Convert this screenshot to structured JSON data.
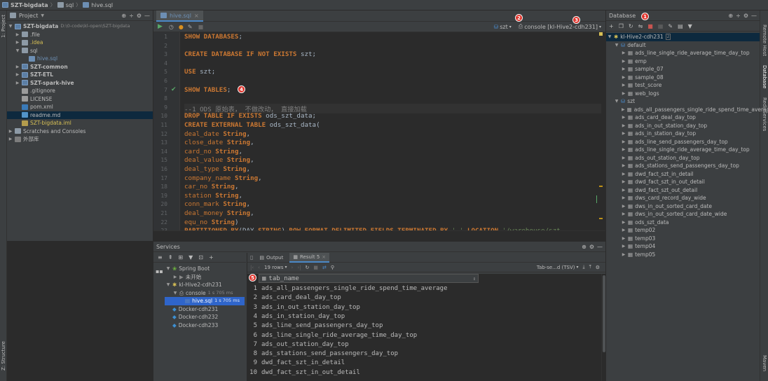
{
  "titlebar": {
    "project": "SZT-bigdata",
    "folder": "sql",
    "file": "hive.sql"
  },
  "leftstrip": {
    "project_tab": "1: Project",
    "structure_tab": "Z: Structure"
  },
  "rightstrip": {
    "remote_host": "Remote Host",
    "database": "Database",
    "redis": "RedisServices",
    "maven": "Maven"
  },
  "project": {
    "title": "Project",
    "tree": [
      {
        "label": "SZT-bigdata",
        "extra": "D:\\0-code\\kl-open\\SZT-bigdata",
        "indent": 0,
        "arrow": "▼",
        "icon": "module",
        "bold": true
      },
      {
        "label": ".file",
        "indent": 1,
        "arrow": "▶",
        "icon": "folder"
      },
      {
        "label": ".idea",
        "indent": 1,
        "arrow": "▶",
        "icon": "folder",
        "color": "yellow"
      },
      {
        "label": "sql",
        "indent": 1,
        "arrow": "▼",
        "icon": "folder"
      },
      {
        "label": "hive.sql",
        "indent": 2,
        "arrow": "",
        "icon": "file-sql",
        "color": "file"
      },
      {
        "label": "SZT-common",
        "indent": 1,
        "arrow": "▶",
        "icon": "module",
        "bold": true
      },
      {
        "label": "SZT-ETL",
        "indent": 1,
        "arrow": "▶",
        "icon": "module",
        "bold": true
      },
      {
        "label": "SZT-spark-hive",
        "indent": 1,
        "arrow": "▶",
        "icon": "module",
        "bold": true
      },
      {
        "label": ".gitignore",
        "indent": 1,
        "arrow": "",
        "icon": "file-txt"
      },
      {
        "label": "LICENSE",
        "indent": 1,
        "arrow": "",
        "icon": "file-txt"
      },
      {
        "label": "pom.xml",
        "indent": 1,
        "arrow": "",
        "icon": "file-xml"
      },
      {
        "label": "readme.md",
        "indent": 1,
        "arrow": "",
        "icon": "file-md",
        "selected": true
      },
      {
        "label": "SZT-bigdata.iml",
        "indent": 1,
        "arrow": "",
        "icon": "file-iml",
        "color": "yellow"
      },
      {
        "label": "Scratches and Consoles",
        "indent": 0,
        "arrow": "▶",
        "icon": "folder"
      },
      {
        "label": "外部库",
        "indent": 0,
        "arrow": "▶",
        "icon": "lib"
      }
    ]
  },
  "editor": {
    "tab": "hive.sql",
    "schema": "szt",
    "console": "console [kl-Hive2-cdh231]",
    "lines": [
      {
        "n": "1",
        "html": "<span class='kw'>SHOW DATABASES</span>;"
      },
      {
        "n": "2",
        "html": ""
      },
      {
        "n": "3",
        "html": "<span class='kw'>CREATE DATABASE IF NOT EXISTS</span> szt;"
      },
      {
        "n": "4",
        "html": ""
      },
      {
        "n": "5",
        "html": "<span class='kw'>USE</span> szt;"
      },
      {
        "n": "6",
        "html": ""
      },
      {
        "n": "7",
        "html": "<span class='kw'>SHOW TABLES</span>;"
      },
      {
        "n": "8",
        "html": ""
      },
      {
        "n": "9",
        "html": "<span class='cm'>--1 ODS 原始表， 不做改动， 直接加载</span>"
      },
      {
        "n": "10",
        "html": "<span class='kw'>DROP TABLE IF EXISTS</span> ods_szt_data;"
      },
      {
        "n": "11",
        "html": "<span class='kw'>CREATE EXTERNAL TABLE</span> ods_szt_data("
      },
      {
        "n": "12",
        "html": "<span class='kwc'>deal_date</span> <span class='kw'>String</span>,"
      },
      {
        "n": "13",
        "html": "<span class='kwc'>close_date</span> <span class='kw'>String</span>,"
      },
      {
        "n": "14",
        "html": "<span class='kwc'>card_no</span> <span class='kw'>String</span>,"
      },
      {
        "n": "15",
        "html": "<span class='kwc'>deal_value</span> <span class='kw'>String</span>,"
      },
      {
        "n": "16",
        "html": "<span class='kwc'>deal_type</span> <span class='kw'>String</span>,"
      },
      {
        "n": "17",
        "html": "<span class='kwc'>company_name</span> <span class='kw'>String</span>,"
      },
      {
        "n": "18",
        "html": "<span class='kwc'>car_no</span> <span class='kw'>String</span>,"
      },
      {
        "n": "19",
        "html": "<span class='kwc'>station</span> <span class='kw'>String</span>,"
      },
      {
        "n": "20",
        "html": "<span class='kwc'>conn_mark</span> <span class='kw'>String</span>,"
      },
      {
        "n": "21",
        "html": "<span class='kwc'>deal_money</span> <span class='kw'>String</span>,"
      },
      {
        "n": "22",
        "html": "<span class='kwc'>equ_no</span> <span class='kw'>String</span>)"
      },
      {
        "n": "23",
        "html": "<span class='kw'>PARTITIONED BY</span>(DAY <span class='kw'>STRING</span>) <span class='kw'>ROW FORMAT DELIMITED FIELDS TERMINATED BY</span> <span class='st'>','</span> <span class='kw'>LOCATION</span> <span class='st'>'/warehouse/szt</span>"
      }
    ]
  },
  "database": {
    "title": "Database",
    "tree": [
      {
        "label": "kl-Hive2-cdh231",
        "indent": 0,
        "arrow": "▼",
        "kind": "conn",
        "selected": true,
        "extra": "2"
      },
      {
        "label": "default",
        "indent": 1,
        "arrow": "▼",
        "kind": "schema"
      },
      {
        "label": "ads_line_single_ride_average_time_day_top",
        "indent": 2,
        "arrow": "▶",
        "kind": "table"
      },
      {
        "label": "emp",
        "indent": 2,
        "arrow": "▶",
        "kind": "table"
      },
      {
        "label": "sample_07",
        "indent": 2,
        "arrow": "▶",
        "kind": "table"
      },
      {
        "label": "sample_08",
        "indent": 2,
        "arrow": "▶",
        "kind": "table"
      },
      {
        "label": "test_score",
        "indent": 2,
        "arrow": "▶",
        "kind": "table"
      },
      {
        "label": "web_logs",
        "indent": 2,
        "arrow": "▶",
        "kind": "table"
      },
      {
        "label": "szt",
        "indent": 1,
        "arrow": "▼",
        "kind": "schema"
      },
      {
        "label": "ads_all_passengers_single_ride_spend_time_average",
        "indent": 2,
        "arrow": "▶",
        "kind": "table"
      },
      {
        "label": "ads_card_deal_day_top",
        "indent": 2,
        "arrow": "▶",
        "kind": "table"
      },
      {
        "label": "ads_in_out_station_day_top",
        "indent": 2,
        "arrow": "▶",
        "kind": "table"
      },
      {
        "label": "ads_in_station_day_top",
        "indent": 2,
        "arrow": "▶",
        "kind": "table"
      },
      {
        "label": "ads_line_send_passengers_day_top",
        "indent": 2,
        "arrow": "▶",
        "kind": "table"
      },
      {
        "label": "ads_line_single_ride_average_time_day_top",
        "indent": 2,
        "arrow": "▶",
        "kind": "table"
      },
      {
        "label": "ads_out_station_day_top",
        "indent": 2,
        "arrow": "▶",
        "kind": "table"
      },
      {
        "label": "ads_stations_send_passengers_day_top",
        "indent": 2,
        "arrow": "▶",
        "kind": "table"
      },
      {
        "label": "dwd_fact_szt_in_detail",
        "indent": 2,
        "arrow": "▶",
        "kind": "table"
      },
      {
        "label": "dwd_fact_szt_in_out_detail",
        "indent": 2,
        "arrow": "▶",
        "kind": "table"
      },
      {
        "label": "dwd_fact_szt_out_detail",
        "indent": 2,
        "arrow": "▶",
        "kind": "table"
      },
      {
        "label": "dws_card_record_day_wide",
        "indent": 2,
        "arrow": "▶",
        "kind": "table"
      },
      {
        "label": "dws_in_out_sorted_card_date",
        "indent": 2,
        "arrow": "▶",
        "kind": "table"
      },
      {
        "label": "dws_in_out_sorted_card_date_wide",
        "indent": 2,
        "arrow": "▶",
        "kind": "table"
      },
      {
        "label": "ods_szt_data",
        "indent": 2,
        "arrow": "▶",
        "kind": "table"
      },
      {
        "label": "temp02",
        "indent": 2,
        "arrow": "▶",
        "kind": "table"
      },
      {
        "label": "temp03",
        "indent": 2,
        "arrow": "▶",
        "kind": "table"
      },
      {
        "label": "temp04",
        "indent": 2,
        "arrow": "▶",
        "kind": "table"
      },
      {
        "label": "temp05",
        "indent": 2,
        "arrow": "▶",
        "kind": "table"
      }
    ]
  },
  "services": {
    "title": "Services",
    "tree": [
      {
        "label": "Spring Boot",
        "indent": 0,
        "arrow": "▼",
        "kind": "spring"
      },
      {
        "label": "未开始",
        "indent": 1,
        "arrow": "▶",
        "kind": "none"
      },
      {
        "label": "kl-Hive2-cdh231",
        "indent": 0,
        "arrow": "▼",
        "kind": "conn"
      },
      {
        "label": "console",
        "extra": "1 s 705 ms",
        "indent": 1,
        "arrow": "▼",
        "kind": "console"
      },
      {
        "label": "hive.sql",
        "extra": "1 s 705 ms",
        "indent": 2,
        "arrow": "",
        "kind": "sql",
        "selected": true
      },
      {
        "label": "Docker-cdh231",
        "indent": 0,
        "arrow": "",
        "kind": "docker"
      },
      {
        "label": "Docker-cdh232",
        "indent": 0,
        "arrow": "",
        "kind": "docker"
      },
      {
        "label": "Docker-cdh233",
        "indent": 0,
        "arrow": "",
        "kind": "docker"
      }
    ],
    "tabs": {
      "output": "Output",
      "result": "Result 5"
    },
    "rows_label": "19 rows",
    "export_label": "Tab-se...d (TSV)",
    "column": "tab_name",
    "rows": [
      {
        "n": "1",
        "v": "ads_all_passengers_single_ride_spend_time_average"
      },
      {
        "n": "2",
        "v": "ads_card_deal_day_top"
      },
      {
        "n": "3",
        "v": "ads_in_out_station_day_top"
      },
      {
        "n": "4",
        "v": "ads_in_station_day_top"
      },
      {
        "n": "5",
        "v": "ads_line_send_passengers_day_top"
      },
      {
        "n": "6",
        "v": "ads_line_single_ride_average_time_day_top"
      },
      {
        "n": "7",
        "v": "ads_out_station_day_top"
      },
      {
        "n": "8",
        "v": "ads_stations_send_passengers_day_top"
      },
      {
        "n": "9",
        "v": "dwd_fact_szt_in_detail"
      },
      {
        "n": "10",
        "v": "dwd_fact_szt_in_out_detail"
      }
    ]
  },
  "badges": {
    "b1": "1",
    "b2": "2",
    "b3": "3",
    "b4": "4",
    "b5": "5"
  },
  "colors": {
    "accent": "#4a88c7",
    "badge": "#e0342c",
    "keyword": "#cc7832",
    "comment": "#808080",
    "string": "#6a8759",
    "run": "#59a869"
  }
}
